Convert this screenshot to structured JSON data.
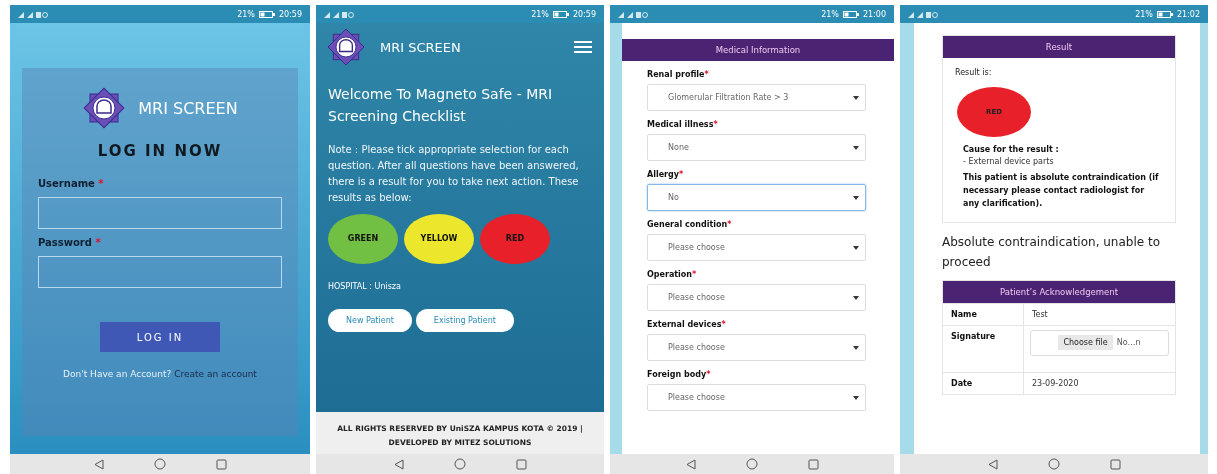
{
  "screens": [
    {
      "kind": "login",
      "status_bar": {
        "battery": "21%",
        "time": "20:59"
      },
      "app_title": "MRI SCREEN",
      "heading": "LOG IN NOW",
      "fields": [
        {
          "label": "Username",
          "required_mark": "*"
        },
        {
          "label": "Password",
          "required_mark": "*"
        }
      ],
      "login_button": "LOG IN",
      "signup_prompt": "Don't Have an Account?",
      "signup_link": "Create an account"
    },
    {
      "kind": "home",
      "status_bar": {
        "battery": "21%",
        "time": "20:59"
      },
      "app_title": "MRI SCREEN",
      "welcome": "Welcome To Magneto Safe - MRI Screening Checklist",
      "note": "Note : Please tick appropriate selection for each question. After all questions have been answered, there is a result for you to take next action. These results as below:",
      "result_levels": [
        {
          "label": "GREEN",
          "color": "#72c043"
        },
        {
          "label": "YELLOW",
          "color": "#ece72c"
        },
        {
          "label": "RED",
          "color": "#e8202a"
        }
      ],
      "hospital": "HOSPITAL : Unisza",
      "buttons": [
        "New Patient",
        "Existing Patient"
      ],
      "footer": "ALL RIGHTS RESERVED BY UniSZA KAMPUS KOTA © 2019 | DEVELOPED BY MITEZ SOLUTIONS"
    },
    {
      "kind": "form",
      "status_bar": {
        "battery": "21%",
        "time": "21:00"
      },
      "section_title": "Medical Information",
      "fields": [
        {
          "label": "Renal profile",
          "required_mark": "*",
          "value": "Glomerular Filtration Rate > 3",
          "focused": false
        },
        {
          "label": "Medical illness",
          "required_mark": "*",
          "value": "None",
          "focused": false
        },
        {
          "label": "Allergy",
          "required_mark": "*",
          "value": "No",
          "focused": true
        },
        {
          "label": "General condition",
          "required_mark": "*",
          "value": "Please choose",
          "focused": false
        },
        {
          "label": "Operation",
          "required_mark": "*",
          "value": "Please choose",
          "focused": false
        },
        {
          "label": "External devices",
          "required_mark": "*",
          "value": "Please choose",
          "focused": false
        },
        {
          "label": "Foreign body",
          "required_mark": "*",
          "value": "Please choose",
          "focused": false
        }
      ]
    },
    {
      "kind": "result",
      "status_bar": {
        "battery": "21%",
        "time": "21:02"
      },
      "section_title": "Result",
      "result_label": "Result is:",
      "result": {
        "label": "RED",
        "color": "#e8202a"
      },
      "cause_title": "Cause for the result :",
      "causes": [
        "- External device parts"
      ],
      "advice": "This patient is absolute contraindication (if necessary please contact radiologist for any clarification).",
      "verdict": "Absolute contraindication, unable to proceed",
      "ack_title": "Patient’s Acknowledgement",
      "ack_rows": [
        {
          "label": "Name",
          "kind": "text",
          "value": "Test"
        },
        {
          "label": "Signature",
          "kind": "file",
          "button": "Choose file",
          "value": "No…n"
        },
        {
          "label": "Date",
          "kind": "text",
          "value": "23-09-2020"
        }
      ]
    }
  ]
}
